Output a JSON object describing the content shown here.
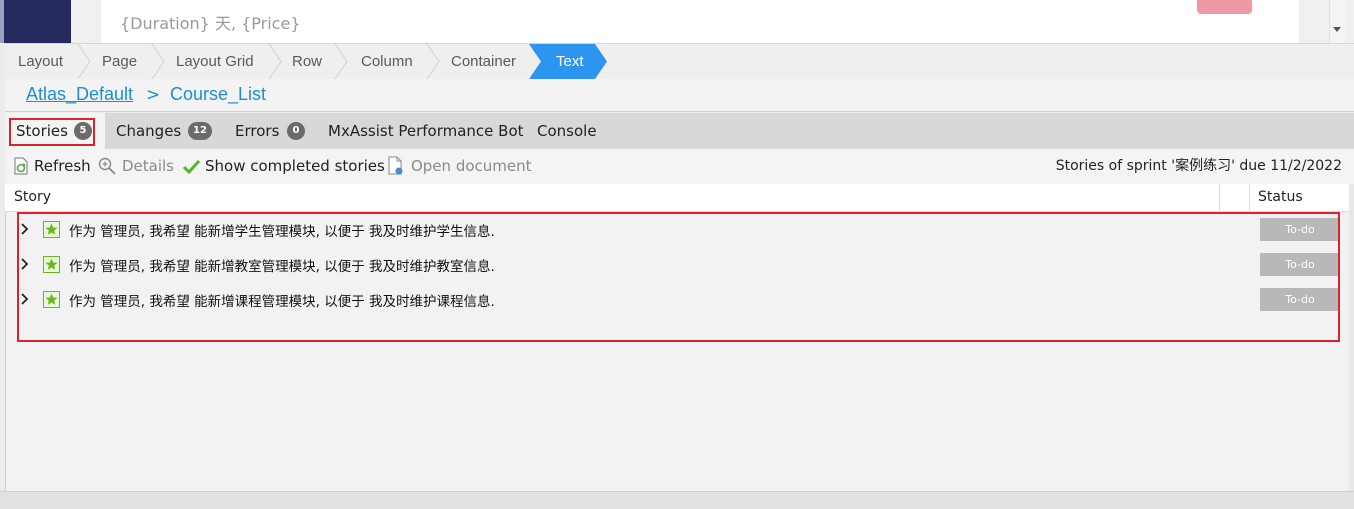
{
  "canvas_preview": {
    "text": "{Duration} 天, {Price}"
  },
  "breadcrumb": {
    "items": [
      "Layout",
      "Page",
      "Layout Grid",
      "Row",
      "Column",
      "Container"
    ],
    "active": "Text"
  },
  "page_path": {
    "module": "Atlas_Default",
    "separator": ">",
    "page": "Course_List"
  },
  "tabs": [
    {
      "label": "Stories",
      "count": "5"
    },
    {
      "label": "Changes",
      "count": "12"
    },
    {
      "label": "Errors",
      "count": "0"
    },
    {
      "label": "MxAssist Performance Bot",
      "count": ""
    },
    {
      "label": "Console",
      "count": ""
    }
  ],
  "toolbar": {
    "refresh_label": "Refresh",
    "details_label": "Details",
    "show_completed_label": "Show completed stories",
    "open_document_label": "Open document",
    "sprint_info": "Stories of sprint '案例练习' due 11/2/2022"
  },
  "table": {
    "columns": {
      "story": "Story",
      "status": "Status"
    },
    "rows": [
      {
        "text": "作为 管理员, 我希望 能新增学生管理模块, 以便于 我及时维护学生信息.",
        "status": "To-do"
      },
      {
        "text": "作为 管理员, 我希望 能新增教室管理模块, 以便于 我及时维护教室信息.",
        "status": "To-do"
      },
      {
        "text": "作为 管理员, 我希望 能新增课程管理模块, 以便于 我及时维护课程信息.",
        "status": "To-do"
      }
    ]
  },
  "colors": {
    "accent_blue": "#2b95ef",
    "link_blue": "#1b8fd1",
    "highlight_red": "#d9232e",
    "status_gray": "#b8b8b8",
    "story_icon_green": "#6ab820"
  },
  "icons": {
    "refresh": "refresh-icon",
    "details": "magnifier-icon",
    "show_completed": "checkmark-icon",
    "open_document": "document-icon",
    "row_expand": "chevron-right-icon",
    "story": "star-icon"
  }
}
